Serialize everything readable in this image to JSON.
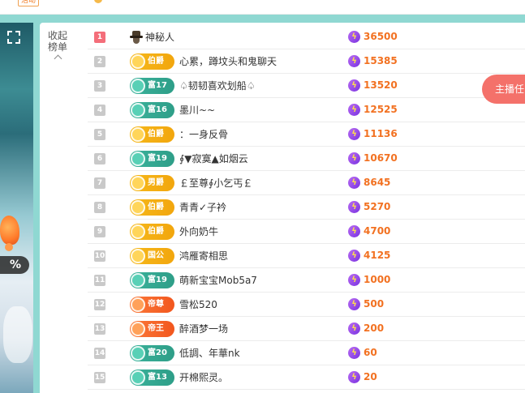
{
  "topbar": {
    "chip_label": "活动",
    "icon": "gift-icon"
  },
  "panel": {
    "collapse_label": "收起榜单",
    "collapse_icon": "chevron-up-icon"
  },
  "host_button": {
    "label": "主播任"
  },
  "colors": {
    "accent_score": "#f27121",
    "rank_first": "#f46e7a",
    "badge_gold": "#f6b81b",
    "badge_teal": "#3bb29b",
    "badge_orange": "#fb7a3a",
    "frame": "#8fd8d2"
  },
  "leaderboard": [
    {
      "rank": "1",
      "badge": "",
      "badge_type": "mystery",
      "name": "神秘人",
      "score": "36500"
    },
    {
      "rank": "2",
      "badge": "伯爵",
      "badge_type": "gold",
      "name": "心累，蹲坟头和鬼聊天",
      "score": "15385"
    },
    {
      "rank": "3",
      "badge": "富17",
      "badge_type": "teal",
      "name": "♤韧韧喜欢划船♤",
      "score": "13520"
    },
    {
      "rank": "4",
      "badge": "富16",
      "badge_type": "teal",
      "name": "墨川~~",
      "score": "12525"
    },
    {
      "rank": "5",
      "badge": "伯爵",
      "badge_type": "gold",
      "name": "：一身反骨",
      "score": "11136"
    },
    {
      "rank": "6",
      "badge": "富19",
      "badge_type": "teal",
      "name": "∮▼寂寞▲如烟云",
      "score": "10670"
    },
    {
      "rank": "7",
      "badge": "男爵",
      "badge_type": "gold",
      "name": "￡至尊∮小乞丐￡",
      "score": "8645"
    },
    {
      "rank": "8",
      "badge": "伯爵",
      "badge_type": "gold",
      "name": "青青✓子衿",
      "score": "5270"
    },
    {
      "rank": "9",
      "badge": "伯爵",
      "badge_type": "gold",
      "name": "外向奶牛",
      "score": "4700"
    },
    {
      "rank": "10",
      "badge": "国公",
      "badge_type": "gold",
      "name": "鸿雁寄相思",
      "score": "4125"
    },
    {
      "rank": "11",
      "badge": "富19",
      "badge_type": "teal",
      "name": "萌新宝宝Mob5a7",
      "score": "1000"
    },
    {
      "rank": "12",
      "badge": "帝尊",
      "badge_type": "orange",
      "name": "雪松520",
      "score": "500"
    },
    {
      "rank": "13",
      "badge": "帝王",
      "badge_type": "orange",
      "name": "醉酒梦一场",
      "score": "200"
    },
    {
      "rank": "14",
      "badge": "富20",
      "badge_type": "teal",
      "name": "低調、年華nk",
      "score": "60"
    },
    {
      "rank": "15",
      "badge": "富13",
      "badge_type": "teal",
      "name": "开棉熙灵。",
      "score": "20"
    }
  ],
  "video": {
    "percent_label": "%"
  }
}
